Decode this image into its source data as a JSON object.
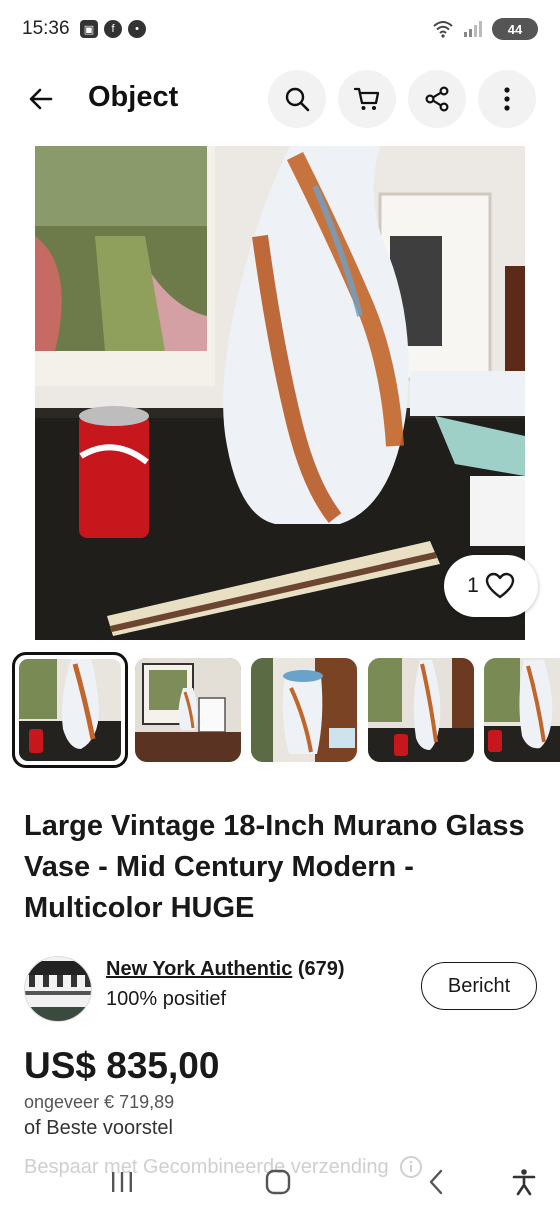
{
  "status_bar": {
    "time": "15:36",
    "left_icons": [
      "screenshot-icon",
      "facebook-icon",
      "notification-icon"
    ],
    "wifi_badge": "5",
    "battery": "44"
  },
  "header": {
    "title": "Object",
    "actions": [
      "search-icon",
      "cart-icon",
      "share-icon",
      "more-icon"
    ]
  },
  "gallery": {
    "like_count": "1",
    "main_photo_alt": "main listing photo",
    "thumbnails": 5
  },
  "listing": {
    "title": "Large Vintage 18-Inch Murano Glass Vase - Mid Century Modern - Multicolor HUGE"
  },
  "seller": {
    "name": "New York Authentic",
    "feedback_count": "(679)",
    "positive": "100% positief",
    "message_label": "Bericht"
  },
  "pricing": {
    "price": "US$ 835,00",
    "approx": "ongeveer € 719,89",
    "best_offer": "of Beste voorstel",
    "shipping_note": "Bespaar met Gecombineerde verzending"
  },
  "colors": {
    "text": "#191919",
    "circle_bg": "#f2f2f2",
    "can_red": "#c8161d"
  }
}
